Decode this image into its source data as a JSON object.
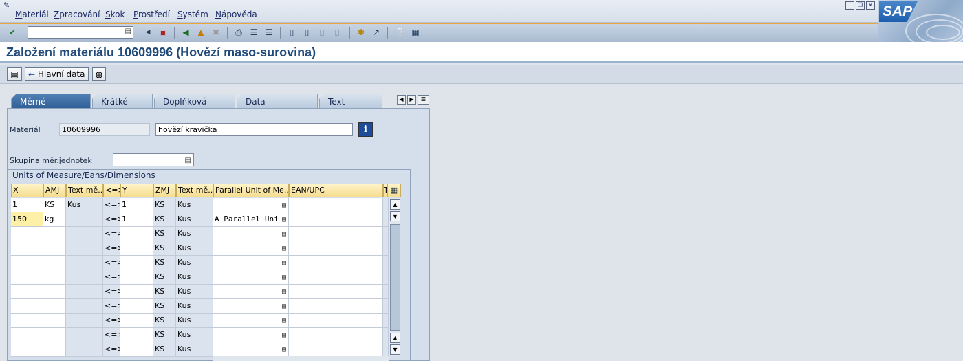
{
  "menu": {
    "items": [
      "Materiál",
      "Zpracování",
      "Skok",
      "Prostředí",
      "Systém",
      "Nápověda"
    ]
  },
  "sap_logo": "SAP",
  "toolbar": {
    "command_value": "",
    "icons": [
      "enter-icon",
      "save-icon",
      "back-icon",
      "exit-icon",
      "cancel-icon",
      "print-icon",
      "find-icon",
      "find-next-icon",
      "first-page-icon",
      "previous-page-icon",
      "next-page-icon",
      "last-page-icon",
      "new-session-icon",
      "shortcut-icon",
      "help-icon",
      "layout-icon"
    ]
  },
  "page": {
    "title": "Založení materiálu 10609996 (Hovězí maso-surovina)"
  },
  "app_toolbar": {
    "main_data_label": "Hlavní data"
  },
  "tabs": [
    {
      "label": "Měrné jednotky",
      "active": true
    },
    {
      "label": "Krátké texty",
      "active": false
    },
    {
      "label": "Doplňková EANs",
      "active": false
    },
    {
      "label": "Data dokumentu",
      "active": false
    },
    {
      "label": "Text základn...",
      "active": false
    }
  ],
  "form": {
    "material_label": "Materiál",
    "material_value": "10609996",
    "material_desc": "hovězí kravička",
    "unit_group_label": "Skupina měr.jednotek",
    "unit_group_value": ""
  },
  "group": {
    "title": "Units of Measure/Eans/Dimensions"
  },
  "table": {
    "headers": [
      "X",
      "AMJ",
      "Text mě...",
      "<=>",
      "Y",
      "ZMJ",
      "Text mě...",
      "Parallel Unit of Me...",
      "EAN/UPC",
      "T"
    ],
    "rows": [
      {
        "x": "1",
        "amj": "KS",
        "text1": "Kus",
        "eq": "<=>",
        "y": "1",
        "zmj": "KS",
        "text2": "Kus",
        "parallel": "",
        "ean": ""
      },
      {
        "x": "150",
        "amj": "kg",
        "text1": "",
        "eq": "<=>",
        "y": "1",
        "zmj": "KS",
        "text2": "Kus",
        "parallel": "A Parallel Uni",
        "ean": ""
      },
      {
        "x": "",
        "amj": "",
        "text1": "",
        "eq": "<=>",
        "y": "",
        "zmj": "KS",
        "text2": "Kus",
        "parallel": "",
        "ean": ""
      },
      {
        "x": "",
        "amj": "",
        "text1": "",
        "eq": "<=>",
        "y": "",
        "zmj": "KS",
        "text2": "Kus",
        "parallel": "",
        "ean": ""
      },
      {
        "x": "",
        "amj": "",
        "text1": "",
        "eq": "<=>",
        "y": "",
        "zmj": "KS",
        "text2": "Kus",
        "parallel": "",
        "ean": ""
      },
      {
        "x": "",
        "amj": "",
        "text1": "",
        "eq": "<=>",
        "y": "",
        "zmj": "KS",
        "text2": "Kus",
        "parallel": "",
        "ean": ""
      },
      {
        "x": "",
        "amj": "",
        "text1": "",
        "eq": "<=>",
        "y": "",
        "zmj": "KS",
        "text2": "Kus",
        "parallel": "",
        "ean": ""
      },
      {
        "x": "",
        "amj": "",
        "text1": "",
        "eq": "<=>",
        "y": "",
        "zmj": "KS",
        "text2": "Kus",
        "parallel": "",
        "ean": ""
      },
      {
        "x": "",
        "amj": "",
        "text1": "",
        "eq": "<=>",
        "y": "",
        "zmj": "KS",
        "text2": "Kus",
        "parallel": "",
        "ean": ""
      },
      {
        "x": "",
        "amj": "",
        "text1": "",
        "eq": "<=>",
        "y": "",
        "zmj": "KS",
        "text2": "Kus",
        "parallel": "",
        "ean": ""
      },
      {
        "x": "",
        "amj": "",
        "text1": "",
        "eq": "<=>",
        "y": "",
        "zmj": "KS",
        "text2": "Kus",
        "parallel": "",
        "ean": ""
      }
    ]
  },
  "colors": {
    "accent": "#1f4a7a",
    "header_bg": "#f5dd8f",
    "selected_cell": "#fff0a8"
  }
}
